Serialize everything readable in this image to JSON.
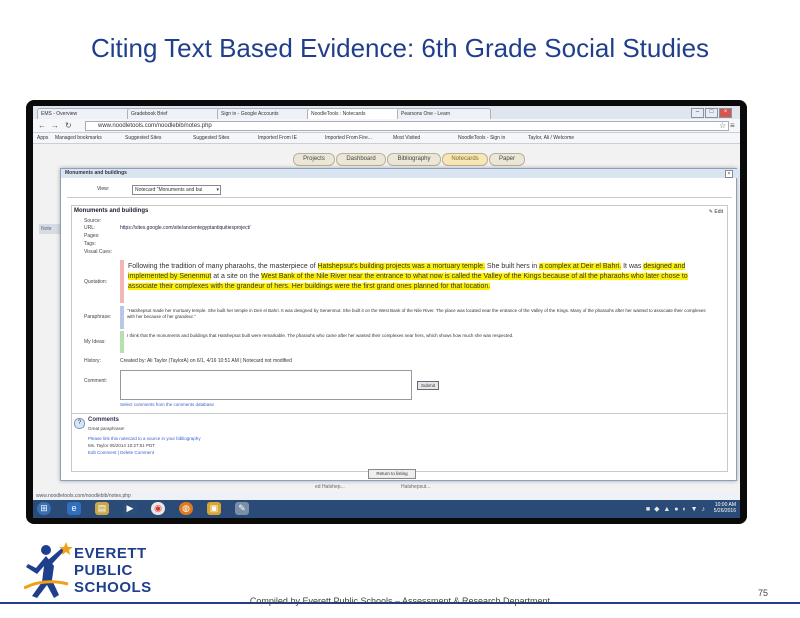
{
  "slide": {
    "title": "Citing Text Based Evidence: 6th Grade Social Studies",
    "footer": "Compiled by Everett Public Schools – Assessment & Research Department",
    "page_number": "75",
    "logo": {
      "line1": "EVERETT",
      "line2": "PUBLIC",
      "line3": "SCHOOLS"
    }
  },
  "browser": {
    "tabs": [
      "EMS - Overview",
      "Gradebook Brief",
      "Sign in - Google Accounts",
      "NoodleTools : Notecards",
      "Pearsons One - Learn"
    ],
    "url": "www.noodletools.com/noodlebib/notes.php",
    "bookmarks": [
      "Apps",
      "Managed bookmarks",
      "Suggested Sites",
      "Suggested Sites",
      "Imported From IE",
      "Imported From Fire...",
      "Most Visited",
      "NoodleTools - Sign in",
      "Taylor, Ali / Welcome"
    ]
  },
  "app_nav": {
    "tabs": [
      "Projects",
      "Dashboard",
      "Bibliography",
      "Notecards",
      "Paper"
    ],
    "active": "Notecards"
  },
  "modal": {
    "title": "Monuments and buildings",
    "view_label": "View:",
    "view_selected": "Notecard \"Monuments and bui",
    "card_title": "Monuments and buildings",
    "edit_label": "Edit",
    "fields": {
      "source_label": "Source:",
      "url_label": "URL:",
      "url_value": "https://sites.google.com/site/ancientegyptantiquitiesproject/",
      "pages_label": "Pages:",
      "tags_label": "Tags:",
      "visual_cues_label": "Visual Cues:",
      "quotation_label": "Quotation:",
      "paraphrase_label": "Paraphrase:",
      "my_ideas_label": "My Ideas:",
      "history_label": "History:",
      "comment_label": "Comment:"
    },
    "quotation": {
      "t1": "Following the tradition of many pharaohs, the masterpiece of ",
      "h1": "Hatshepsut's building projects was a mortuary temple.",
      "t2": " She built hers in ",
      "h2": "a complex at Deir el Bahri.",
      "t3": " It was ",
      "h3": "designed and implemented by Senenmut",
      "t4": " at a site on the ",
      "h4": "West Bank of the Nile River near the entrance to what now is called the Valley of the Kings because of all the pharaohs who later chose to associate their complexes with the grandeur of hers. Her buildings were the first grand ones planned for that location.",
      "t5": ""
    },
    "paraphrase": "\"Hatshepsut made her mortuary temple. She built her temple in Deir el Bahri. It was designed by Senenmut. She built it on the West Bank of the Nile River. The place was located near the entrance of the Valley of the Kings. Many of the pharaohs after her wanted to associate their complexes with her because of her grandeur.\"",
    "my_ideas": "I think that the monuments and buildings that Hatshepsut built were remarkable. The pharaohs who came after her wanted their complexes near hers, which shows how much she was respected.",
    "history": "Created by: Ali Taylor (TaylorA) on 6/1, 4/16 10:51 AM  |  Notecard not modified",
    "submit_label": "Submit",
    "link_small": "Select comments from the comments database",
    "comments_title": "Comments",
    "comment_lines": [
      "Great paraphrase!",
      "Please link this notecard to a source in your bibliography",
      "Ms. Taylor 05/2014 10:27:51 PDT",
      "Edit Comment | Delete Comment"
    ],
    "return_label": "Return to listing"
  },
  "background": {
    "side_note": "Note",
    "status_url": "www.noodletools.com/noodlebib/notes.php",
    "bg_snippet1": "ed Hatshep...",
    "bg_snippet2": "Hatshepsut..."
  },
  "taskbar": {
    "time": "10:00 AM",
    "date": "5/26/2016"
  }
}
